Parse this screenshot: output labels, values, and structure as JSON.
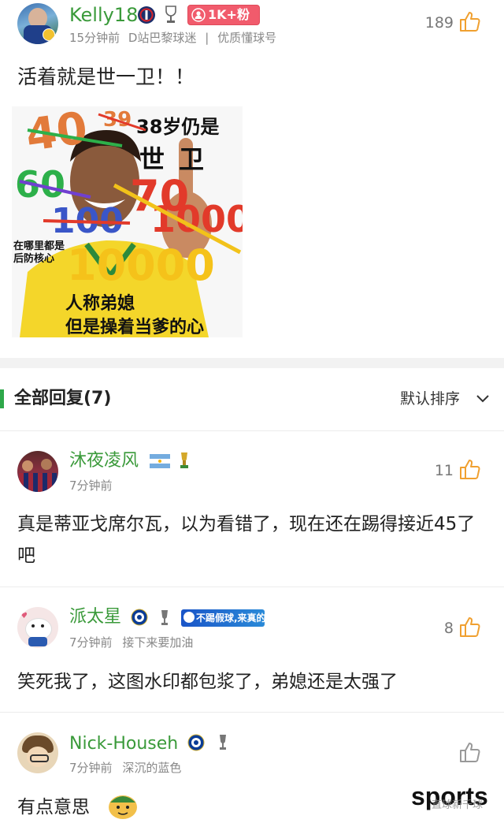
{
  "colors": {
    "username": "#3a9a3a",
    "accent_green": "#2ea84a",
    "thumb_orange": "#f0a030",
    "fans_badge": "#e85a6a"
  },
  "post": {
    "username": "Kelly18",
    "fans_badge": "1K+粉",
    "time": "15分钟前",
    "tag1": "D站巴黎球迷",
    "separator": "|",
    "tag2": "优质懂球号",
    "likes": "189",
    "text": "活着就是世一卫！！",
    "image": {
      "texts": {
        "top": "38岁仍是",
        "mid": "世卫",
        "left1": "在哪里都是",
        "left2": "后防核心",
        "bottom1": "人称弟媳",
        "bottom2": "但是操着当爹的心"
      },
      "numbers": [
        "40",
        "39",
        "60",
        "70",
        "100",
        "1000",
        "10000"
      ]
    }
  },
  "replies_header": {
    "title": "全部回复(7)",
    "sort_label": "默认排序"
  },
  "replies": [
    {
      "username": "沐夜凌风",
      "time": "7分钟前",
      "tag": "",
      "likes": "11",
      "text": "真是蒂亚戈席尔瓦，以为看错了，现在还在踢得接近45了吧"
    },
    {
      "username": "派太星",
      "time": "7分钟前",
      "tag": "接下来要加油",
      "likes": "8",
      "badge": "不踢假球,来真的",
      "text": "笑死我了，这图水印都包浆了，弟媳还是太强了"
    },
    {
      "username": "Nick-Househ",
      "time": "7分钟前",
      "tag": "深沉的蓝色",
      "likes": "",
      "text": "有点意思"
    }
  ],
  "watermark": {
    "main": "sports",
    "sub": "直球新千球"
  },
  "icons": [
    "avatar",
    "psg-crest-icon",
    "trophy-icon",
    "fans-person-icon",
    "thumbs-up-icon",
    "flag-argentina-icon",
    "world-cup-icon",
    "chelsea-crest-icon",
    "chevron-down-icon",
    "emoji-face-icon"
  ]
}
